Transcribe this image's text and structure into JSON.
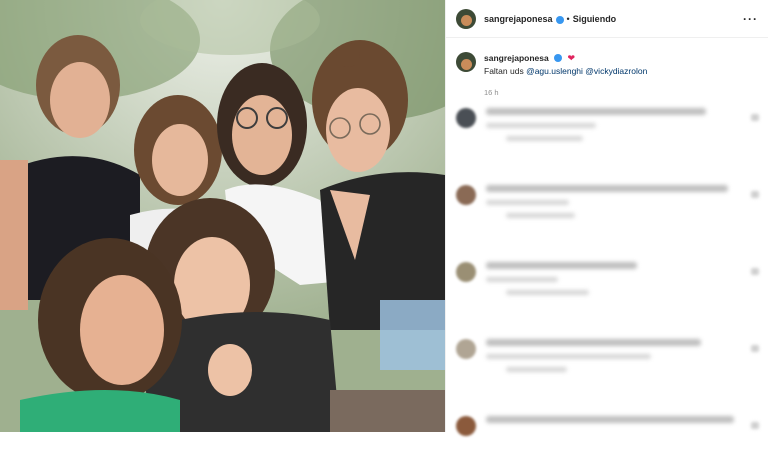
{
  "post": {
    "username": "sangrejaponesa",
    "follow_status": "Siguiendo",
    "separator": "•",
    "more_label": "···",
    "caption_text": "Faltan uds",
    "mentions": [
      "@agu.uslenghi",
      "@vickydiazrolon"
    ],
    "heart_emoji": "❤",
    "timestamp": "16 h"
  },
  "comments": [
    {
      "avatar_color": "#4a4f55"
    },
    {
      "avatar_color": "#8a6a55"
    },
    {
      "avatar_color": "#9a8f74"
    },
    {
      "avatar_color": "#b0a594"
    },
    {
      "avatar_color": "#8b5a3c"
    }
  ]
}
